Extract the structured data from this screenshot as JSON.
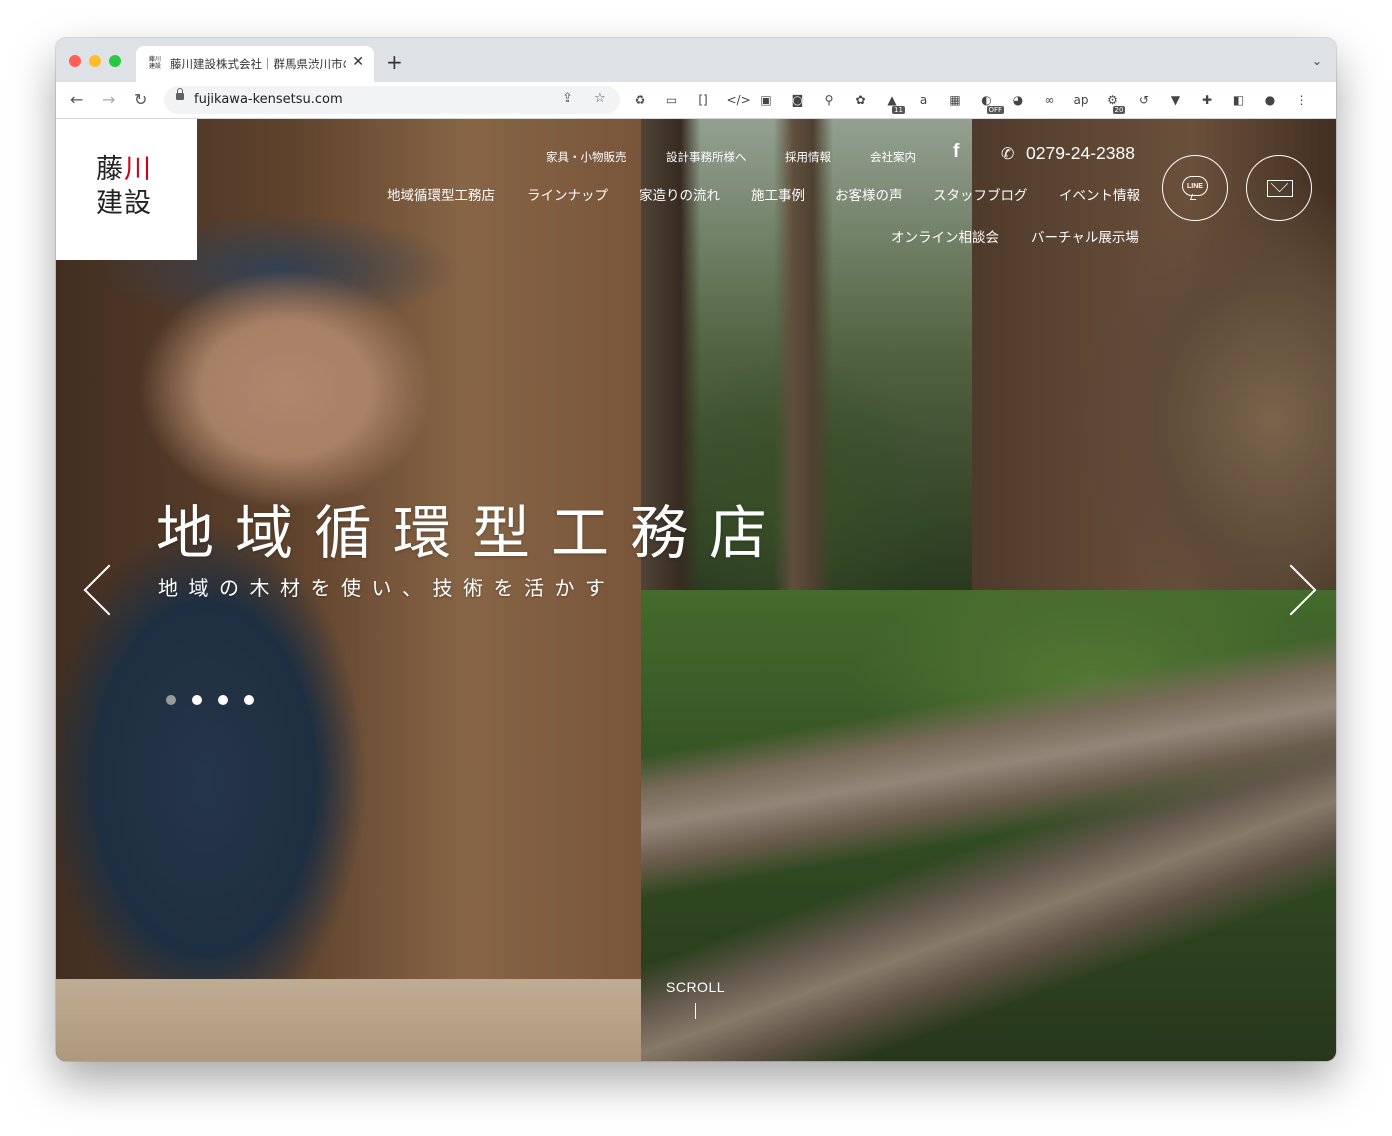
{
  "browser": {
    "tab_title": "藤川建設株式会社｜群馬県渋川市の",
    "tab_favicon_top": "藤川",
    "tab_favicon_bottom": "建設",
    "new_tab_icon": "+",
    "close_icon": "✕",
    "tab_menu_icon": "⌄",
    "url": "fujikawa-kensetsu.com",
    "extensions": [
      {
        "name": "recycle-icon",
        "glyph": "♻"
      },
      {
        "name": "screenshot-ext-icon",
        "glyph": "▭"
      },
      {
        "name": "bracket-ext-icon",
        "glyph": "[]"
      },
      {
        "name": "code-ext-icon",
        "glyph": "</>"
      },
      {
        "name": "green-monster-icon",
        "glyph": "▣"
      },
      {
        "name": "camera-icon",
        "glyph": "◙"
      },
      {
        "name": "pin-icon",
        "glyph": "⚲"
      },
      {
        "name": "color-wheel-icon",
        "glyph": "✿"
      },
      {
        "name": "graduation-cap-icon",
        "glyph": "▲",
        "badge": "11"
      },
      {
        "name": "amazon-icon",
        "glyph": "a"
      },
      {
        "name": "qr-code-icon",
        "glyph": "▦"
      },
      {
        "name": "gauge-icon",
        "glyph": "◐",
        "badge": "OFF"
      },
      {
        "name": "globe-icon",
        "glyph": "◕"
      },
      {
        "name": "link-icon",
        "glyph": "∞"
      },
      {
        "name": "ap-icon",
        "glyph": "ap"
      },
      {
        "name": "gear-ext-icon",
        "glyph": "⚙",
        "badge": "20"
      },
      {
        "name": "history-icon",
        "glyph": "↺"
      },
      {
        "name": "vee-icon",
        "glyph": "▼"
      },
      {
        "name": "puzzle-icon",
        "glyph": "✚"
      },
      {
        "name": "sidebar-icon",
        "glyph": "◧"
      },
      {
        "name": "profile-icon",
        "glyph": "●"
      },
      {
        "name": "kebab-menu-icon",
        "glyph": "⋮"
      }
    ]
  },
  "site": {
    "logo_line1_a": "藤",
    "logo_line1_b": "川",
    "logo_line2": "建設",
    "utility_nav": [
      "家具・小物販売",
      "設計事務所様へ",
      "採用情報",
      "会社案内"
    ],
    "facebook_glyph": "f",
    "phone": "0279-24-2388",
    "main_nav": [
      "地域循環型工務店",
      "ラインナップ",
      "家造りの流れ",
      "施工事例",
      "お客様の声",
      "スタッフブログ",
      "イベント情報"
    ],
    "sub_nav": [
      "オンライン相談会",
      "バーチャル展示場"
    ],
    "line_label": "LINE",
    "hero_title": "地域循環型工務店",
    "hero_subtitle": "地域の木材を使い、技術を活かす",
    "slider_dots": [
      false,
      true,
      true,
      true
    ],
    "scroll_label": "SCROLL"
  },
  "colors": {
    "accent_red": "#d0021b",
    "chrome_bg": "#dee1e6"
  }
}
